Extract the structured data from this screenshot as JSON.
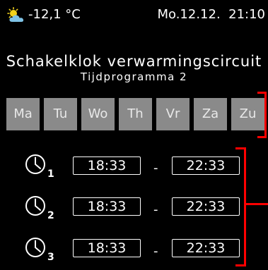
{
  "status": {
    "weather_icon": "sun-behind-cloud-icon",
    "temperature": "-12,1 °C",
    "date": "Mo.12.12.",
    "time": "21:10"
  },
  "header": {
    "title": "Schakelklok verwarmingscircuit",
    "subtitle": "Tijdprogramma 2"
  },
  "days": [
    "Ma",
    "Tu",
    "Wo",
    "Th",
    "Vr",
    "Za",
    "Zu"
  ],
  "slots": [
    {
      "number": "1",
      "start": "18:33",
      "separator": "-",
      "end": "22:33"
    },
    {
      "number": "2",
      "start": "18:33",
      "separator": "-",
      "end": "22:33"
    },
    {
      "number": "3",
      "start": "18:33",
      "separator": "-",
      "end": "22:33"
    }
  ],
  "colors": {
    "background": "#000000",
    "day_button": "#8a8a8a",
    "highlight": "#ff0000",
    "sun": "#f2d21b",
    "cloud": "#7fc3e6"
  }
}
